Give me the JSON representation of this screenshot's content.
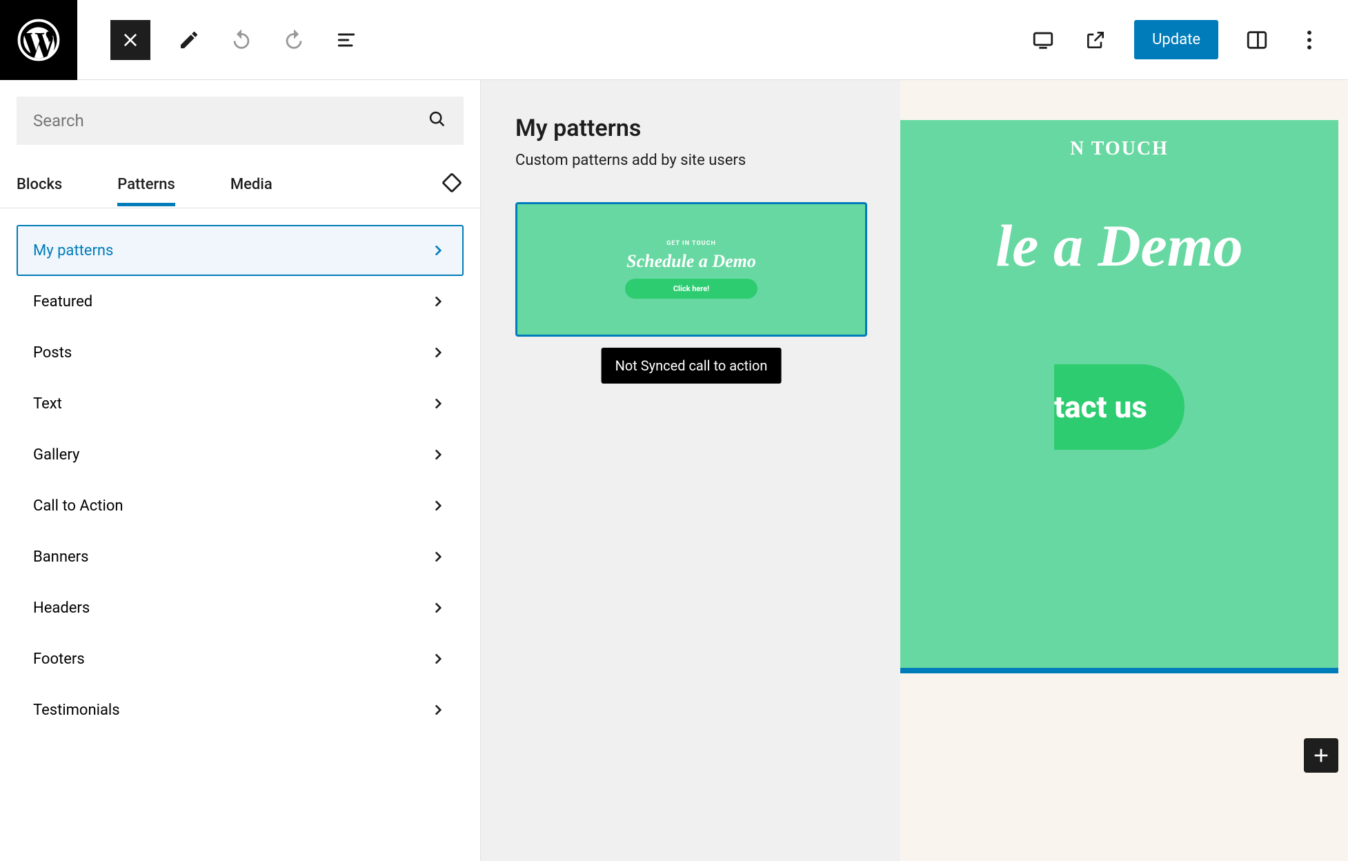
{
  "topbar": {
    "update_label": "Update"
  },
  "search": {
    "placeholder": "Search"
  },
  "tabs": {
    "blocks": "Blocks",
    "patterns": "Patterns",
    "media": "Media"
  },
  "categories": [
    {
      "label": "My patterns",
      "selected": true
    },
    {
      "label": "Featured",
      "selected": false
    },
    {
      "label": "Posts",
      "selected": false
    },
    {
      "label": "Text",
      "selected": false
    },
    {
      "label": "Gallery",
      "selected": false
    },
    {
      "label": "Call to Action",
      "selected": false
    },
    {
      "label": "Banners",
      "selected": false
    },
    {
      "label": "Headers",
      "selected": false
    },
    {
      "label": "Footers",
      "selected": false
    },
    {
      "label": "Testimonials",
      "selected": false
    }
  ],
  "mid": {
    "title": "My patterns",
    "subtitle": "Custom patterns add by site users"
  },
  "pattern_preview": {
    "kicker": "GET IN TOUCH",
    "title": "Schedule a Demo",
    "button": "Click here!",
    "tooltip": "Not Synced call to action"
  },
  "canvas": {
    "kicker": "N TOUCH",
    "title": "le a Demo",
    "button": "tact us"
  }
}
